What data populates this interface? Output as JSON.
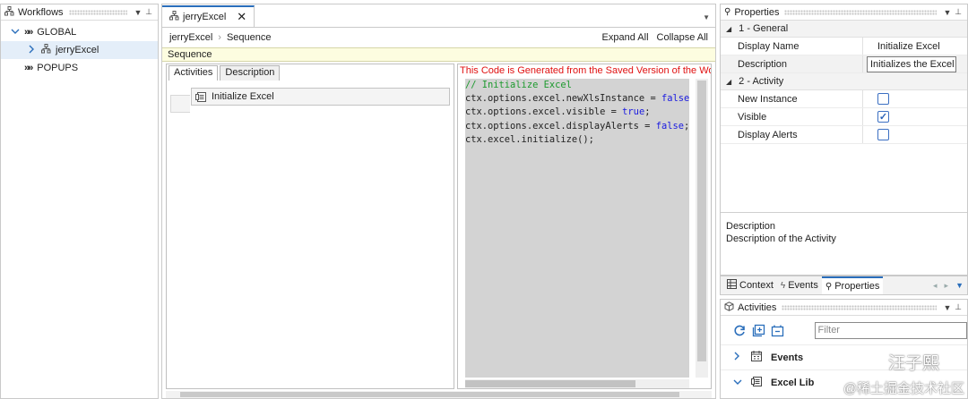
{
  "workflows": {
    "title": "Workflows",
    "tree": [
      {
        "label": "GLOBAL"
      },
      {
        "label": "jerryExcel"
      },
      {
        "label": "POPUPS"
      }
    ]
  },
  "editor": {
    "tab_label": "jerryExcel",
    "breadcrumb": [
      "jerryExcel",
      "Sequence"
    ],
    "expand_all": "Expand All",
    "collapse_all": "Collapse All",
    "sequence_label": "Sequence",
    "inner_tabs": [
      "Activities",
      "Description"
    ],
    "activity_label": "Initialize Excel",
    "generated_msg": "This Code is Generated from the Saved Version of the Wo",
    "code_lines": [
      "// Initialize Excel",
      "ctx.options.excel.newXlsInstance = false;",
      "ctx.options.excel.visible = true;",
      "ctx.options.excel.displayAlerts = false;",
      "ctx.excel.initialize();"
    ]
  },
  "properties": {
    "title": "Properties",
    "categories": [
      {
        "label": "1 - General",
        "rows": [
          {
            "name": "Display Name",
            "value": "Initialize Excel"
          },
          {
            "name": "Description",
            "value": "Initializes the Excel li"
          }
        ]
      },
      {
        "label": "2 - Activity",
        "rows": [
          {
            "name": "New Instance",
            "checked": false
          },
          {
            "name": "Visible",
            "checked": true
          },
          {
            "name": "Display Alerts",
            "checked": false
          }
        ]
      }
    ],
    "desc_title": "Description",
    "desc_text": "Description of the Activity"
  },
  "bottom_tabs": [
    "Context",
    "Events",
    "Properties"
  ],
  "activities": {
    "title": "Activities",
    "filter_placeholder": "Filter",
    "categories": [
      "Events",
      "Excel Lib"
    ]
  },
  "watermark": {
    "line1": "汪子熙",
    "line2": "@稀土掘金技术社区"
  },
  "colors": {
    "accent": "#2a6ebb",
    "code_comment": "#1d9a2e",
    "code_keyword": "#1a1ae0",
    "warning": "#e01010"
  }
}
